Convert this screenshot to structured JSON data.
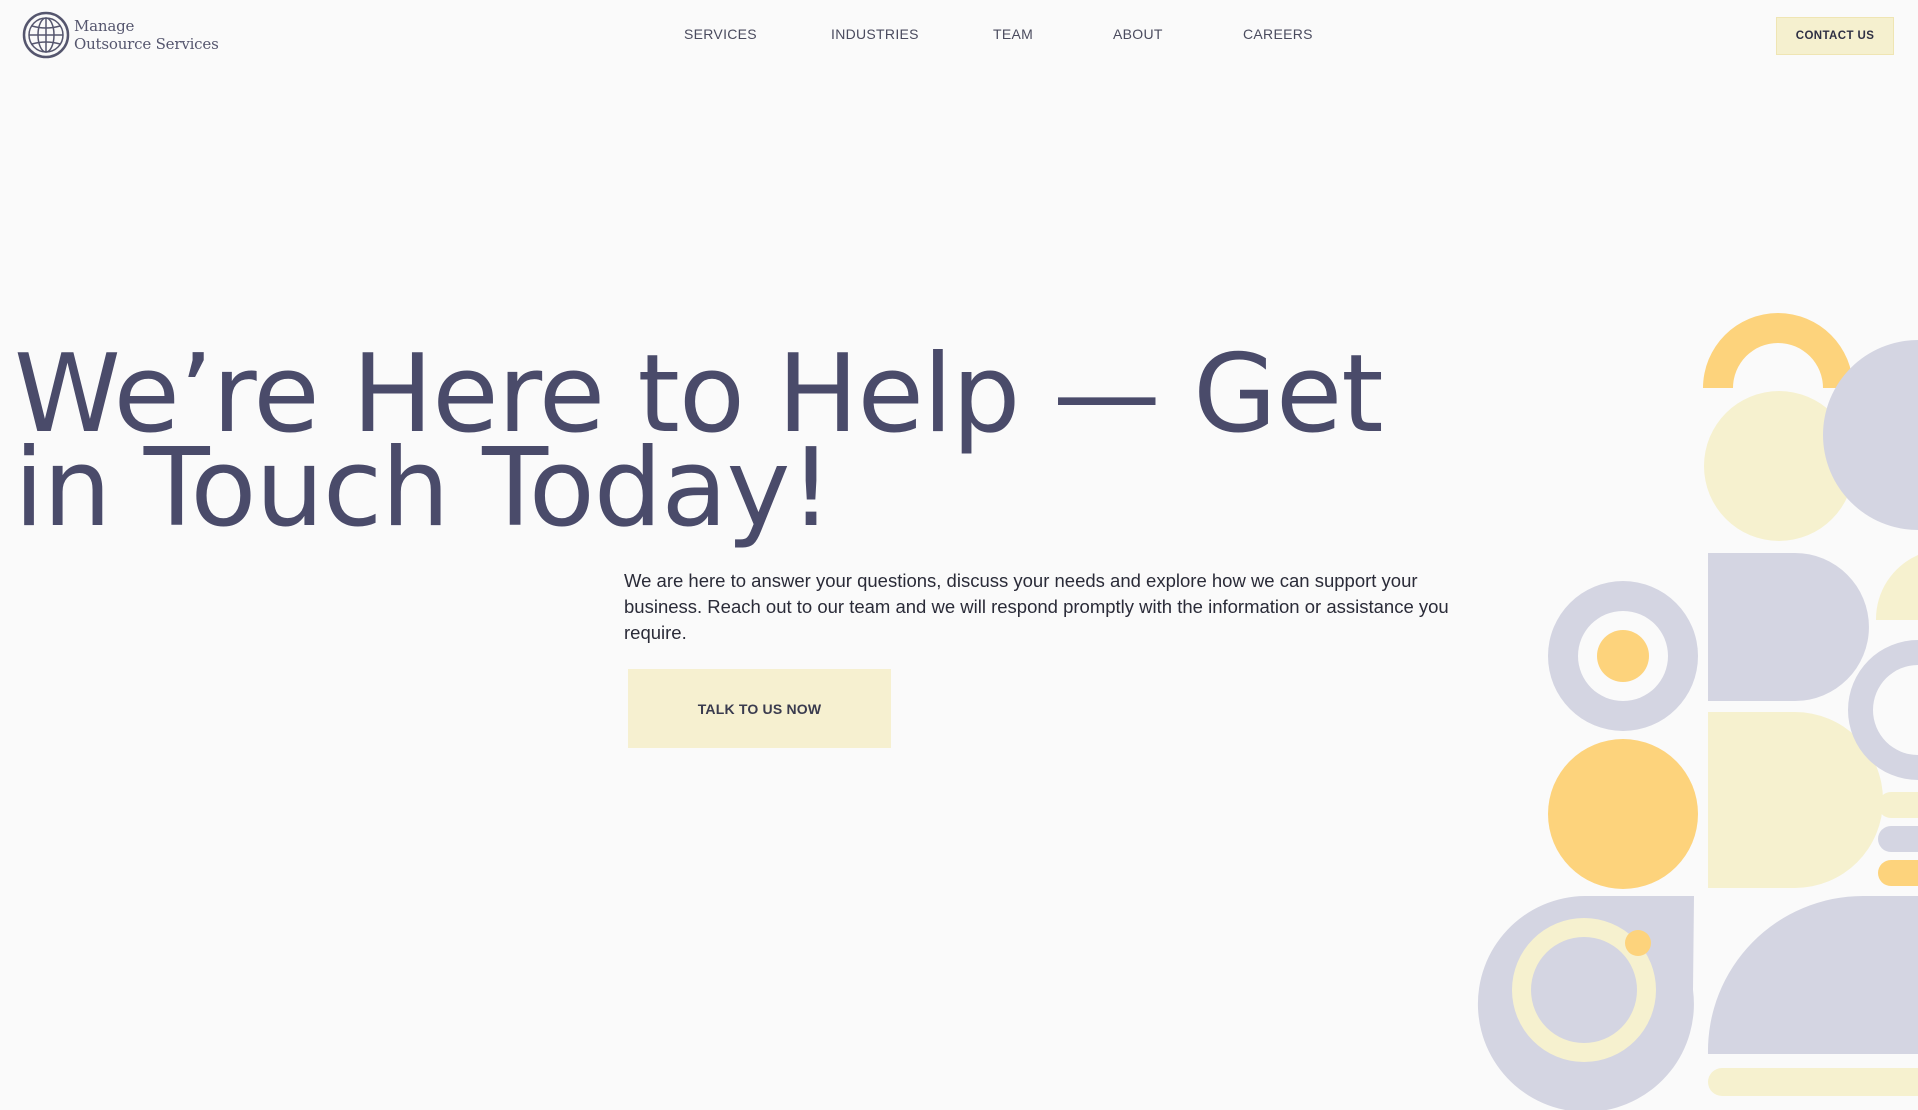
{
  "brand": {
    "logo_line1": "Manage",
    "logo_line2": "Outsource Services",
    "logo_icon": "globe-icon"
  },
  "nav": {
    "items": [
      {
        "label": "SERVICES"
      },
      {
        "label": "INDUSTRIES"
      },
      {
        "label": "TEAM"
      },
      {
        "label": "ABOUT"
      },
      {
        "label": "CAREERS"
      }
    ],
    "contact_label": "CONTACT US"
  },
  "hero": {
    "title": "We’re Here to Help — Get in Touch Today!",
    "description": "We are here to answer your questions, discuss your needs and explore how we can support your business. Reach out to our team and we will respond promptly with the information or assistance you require.",
    "cta_label": "TALK TO US NOW"
  },
  "colors": {
    "background": "#fafafa",
    "title": "#4a4b6a",
    "button_bg": "#f6f0d0",
    "accent_yellow": "#fdd37c",
    "accent_lavender": "#d4d5e2",
    "accent_cream": "#f6f1cf"
  }
}
